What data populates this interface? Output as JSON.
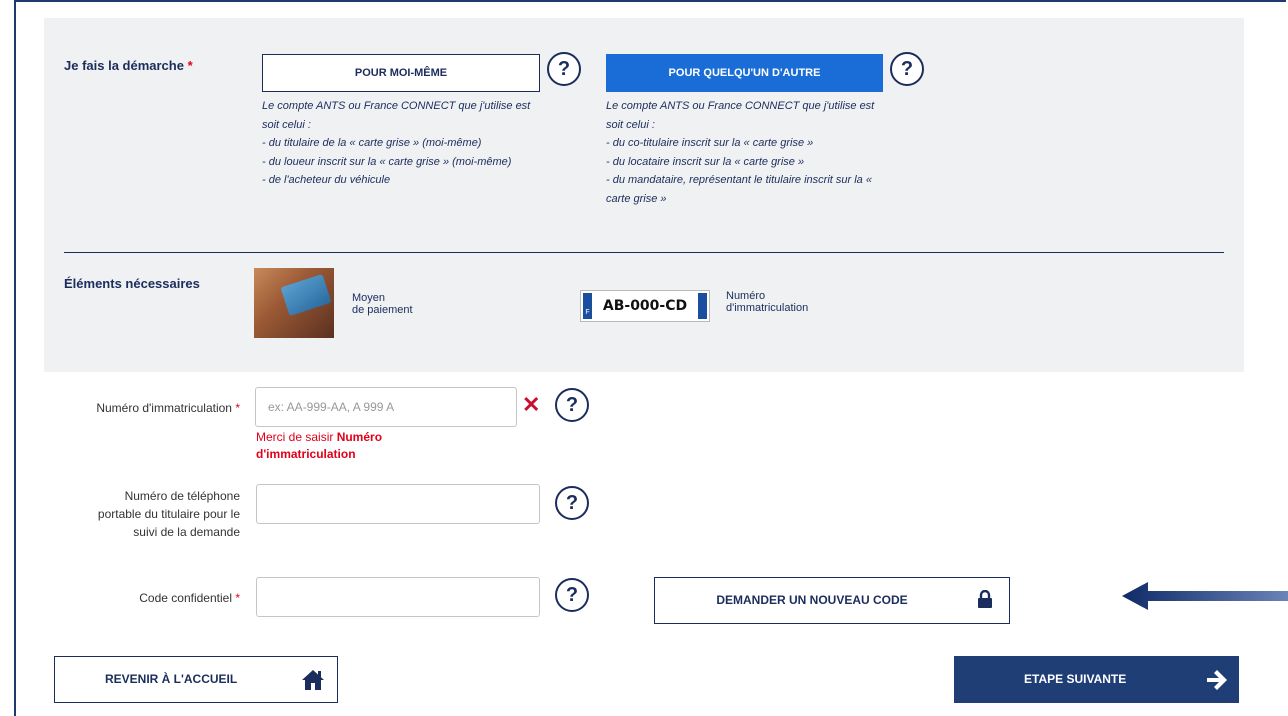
{
  "section": {
    "demarche_label": "Je fais la démarche",
    "required_mark": "*",
    "self_button": "POUR MOI-MÊME",
    "other_button": "POUR QUELQU'UN D'AUTRE",
    "help_glyph": "?",
    "self_desc": [
      "Le compte ANTS ou France CONNECT que j'utilise est",
      "soit celui :",
      "- du titulaire de la « carte grise » (moi-même)",
      "- du loueur inscrit sur la « carte grise » (moi-même)",
      "- de l'acheteur du véhicule"
    ],
    "other_desc": [
      "Le compte ANTS ou France CONNECT que j'utilise est",
      "soit celui :",
      "- du co-titulaire inscrit sur la « carte grise »",
      "- du locataire inscrit sur la « carte grise »",
      "- du mandataire, représentant le titulaire inscrit sur la «",
      "carte grise »"
    ],
    "elements_label": "Éléments nécessaires",
    "payment_line1": "Moyen",
    "payment_line2": "de paiement",
    "plate_number": "AB-000-CD",
    "plate_eu": "F",
    "plate_label_line1": "Numéro",
    "plate_label_line2": "d'immatriculation"
  },
  "form": {
    "immat_label": "Numéro d'immatriculation",
    "immat_placeholder": "ex: AA-999-AA, A 999 A",
    "immat_value": "",
    "clear_glyph": "✕",
    "error_prefix": "Merci de saisir ",
    "error_field": "Numéro d'immatriculation",
    "phone_label_line1": "Numéro de téléphone",
    "phone_label_line2": "portable du titulaire pour le",
    "phone_label_line3": "suivi de la demande",
    "phone_value": "",
    "code_label": "Code confidentiel",
    "code_value": "",
    "new_code_button": "DEMANDER UN NOUVEAU CODE"
  },
  "footer": {
    "home_button": "REVENIR À L'ACCUEIL",
    "next_button": "ETAPE SUIVANTE"
  },
  "colors": {
    "navy": "#1b2d5c",
    "blue_active": "#1a6dd6",
    "required_red": "#e2001a",
    "panel_gray": "#eff1f2"
  },
  "icons": [
    "help-icon",
    "clear-icon",
    "lock-icon",
    "home-icon",
    "arrow-right-icon",
    "arrow-left-pointer-icon"
  ]
}
